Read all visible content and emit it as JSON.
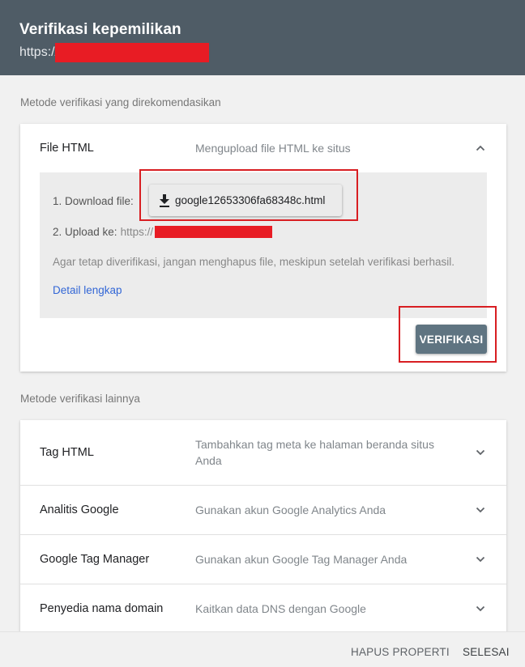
{
  "header": {
    "title": "Verifikasi kepemilikan",
    "url_prefix": "https://"
  },
  "recommended": {
    "section_label": "Metode verifikasi yang direkomendasikan",
    "method": {
      "title": "File HTML",
      "description": "Mengupload file HTML ke situs",
      "step1_label": "1. Download file:",
      "download_filename": "google12653306fa68348c.html",
      "step2_label": "2. Upload ke:",
      "step2_url_prefix": "https://",
      "warning": "Agar tetap diverifikasi, jangan menghapus file, meskipun setelah verifikasi berhasil.",
      "detail_link": "Detail lengkap",
      "verify_button": "VERIFIKASI"
    }
  },
  "other": {
    "section_label": "Metode verifikasi lainnya",
    "methods": [
      {
        "title": "Tag HTML",
        "description": "Tambahkan tag meta ke halaman beranda situs Anda"
      },
      {
        "title": "Analitis Google",
        "description": "Gunakan akun Google Analytics Anda"
      },
      {
        "title": "Google Tag Manager",
        "description": "Gunakan akun Google Tag Manager Anda"
      },
      {
        "title": "Penyedia nama domain",
        "description": "Kaitkan data DNS dengan Google"
      }
    ]
  },
  "footer": {
    "delete_label": "HAPUS PROPERTI",
    "done_label": "SELESAI"
  },
  "colors": {
    "header_bg": "#4f5c66",
    "verify_button_bg": "#5f7481",
    "link": "#3367d6",
    "redaction": "#e81c24",
    "highlight_box": "#d81e22"
  },
  "icons": [
    "download-icon",
    "chevron-up-icon",
    "chevron-down-icon"
  ]
}
